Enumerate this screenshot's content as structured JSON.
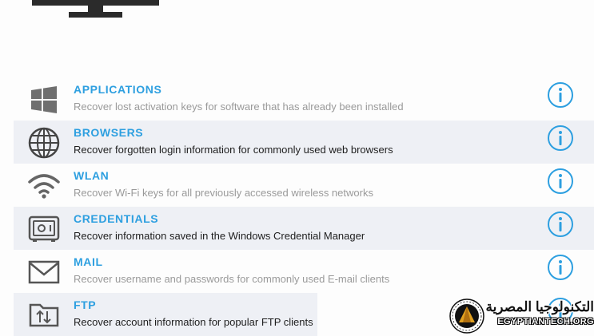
{
  "rows": [
    {
      "title": "APPLICATIONS",
      "description": "Recover lost activation keys for software that has already been installed",
      "icon": "windows-icon"
    },
    {
      "title": "BROWSERS",
      "description": "Recover forgotten login information for commonly used web browsers",
      "icon": "globe-icon"
    },
    {
      "title": "WLAN",
      "description": "Recover Wi-Fi keys for all previously accessed wireless networks",
      "icon": "wifi-icon"
    },
    {
      "title": "CREDENTIALS",
      "description": "Recover information saved in the Windows Credential Manager",
      "icon": "safe-icon"
    },
    {
      "title": "MAIL",
      "description": "Recover username and passwords for commonly used E-mail clients",
      "icon": "envelope-icon"
    },
    {
      "title": "FTP",
      "description": "Recover account information for popular FTP clients",
      "icon": "ftp-transfer-icon"
    }
  ],
  "watermark": {
    "arabic": "التكنولوجيا المصرية",
    "english": "EGYPTIANTECH.ORG"
  },
  "colors": {
    "title": "#2d9fe0",
    "icon": "#555555",
    "info": "#2d9fe0",
    "alt_row": "#eef0f5"
  }
}
